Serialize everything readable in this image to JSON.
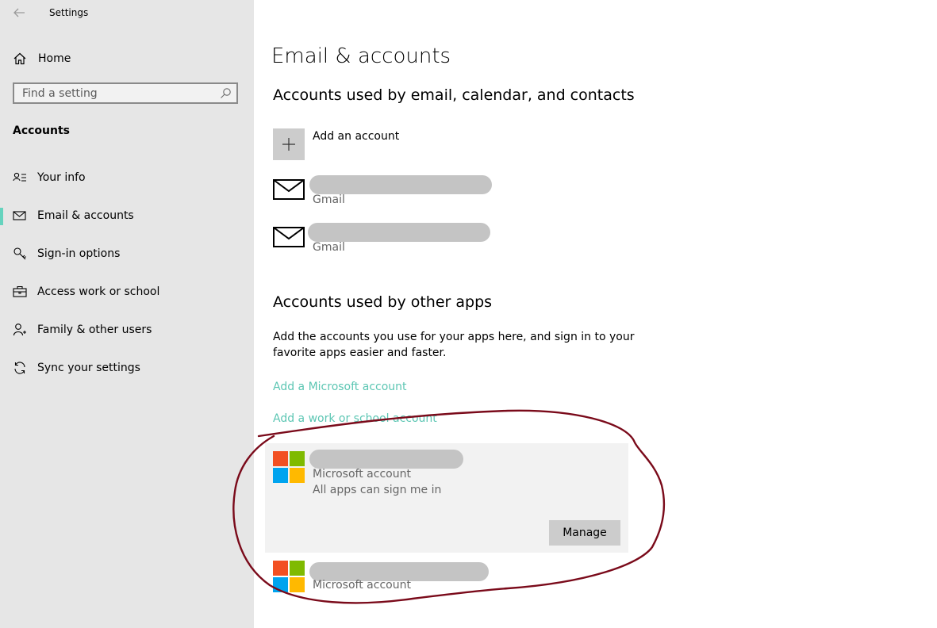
{
  "window": {
    "title": "Settings"
  },
  "sidebar": {
    "home_label": "Home",
    "search_placeholder": "Find a setting",
    "section_label": "Accounts",
    "items": [
      {
        "label": "Your info",
        "icon": "contact-info-icon",
        "selected": false
      },
      {
        "label": "Email & accounts",
        "icon": "mail-icon",
        "selected": true
      },
      {
        "label": "Sign-in options",
        "icon": "key-icon",
        "selected": false
      },
      {
        "label": "Access work or school",
        "icon": "briefcase-icon",
        "selected": false
      },
      {
        "label": "Family & other users",
        "icon": "person-add-icon",
        "selected": false
      },
      {
        "label": "Sync your settings",
        "icon": "sync-icon",
        "selected": false
      }
    ]
  },
  "main": {
    "title": "Email & accounts",
    "email_section": {
      "heading": "Accounts used by email, calendar, and contacts",
      "add_label": "Add an account",
      "accounts": [
        {
          "provider": "Gmail"
        },
        {
          "provider": "Gmail"
        }
      ]
    },
    "apps_section": {
      "heading": "Accounts used by other apps",
      "description": "Add the accounts you use for your apps here, and sign in to your favorite apps easier and faster.",
      "link_microsoft": "Add a Microsoft account",
      "link_work": "Add a work or school account",
      "accounts": [
        {
          "type": "Microsoft account",
          "detail": "All apps can sign me in",
          "manage_label": "Manage"
        },
        {
          "type": "Microsoft account"
        }
      ]
    }
  },
  "colors": {
    "accent": "#66d3be",
    "link": "#5cc6b3",
    "sidebar_bg": "#e6e6e6",
    "annotation": "#7a0a1a",
    "ms_red": "#f25022",
    "ms_green": "#7fba00",
    "ms_blue": "#00a4ef",
    "ms_yellow": "#ffb900"
  }
}
